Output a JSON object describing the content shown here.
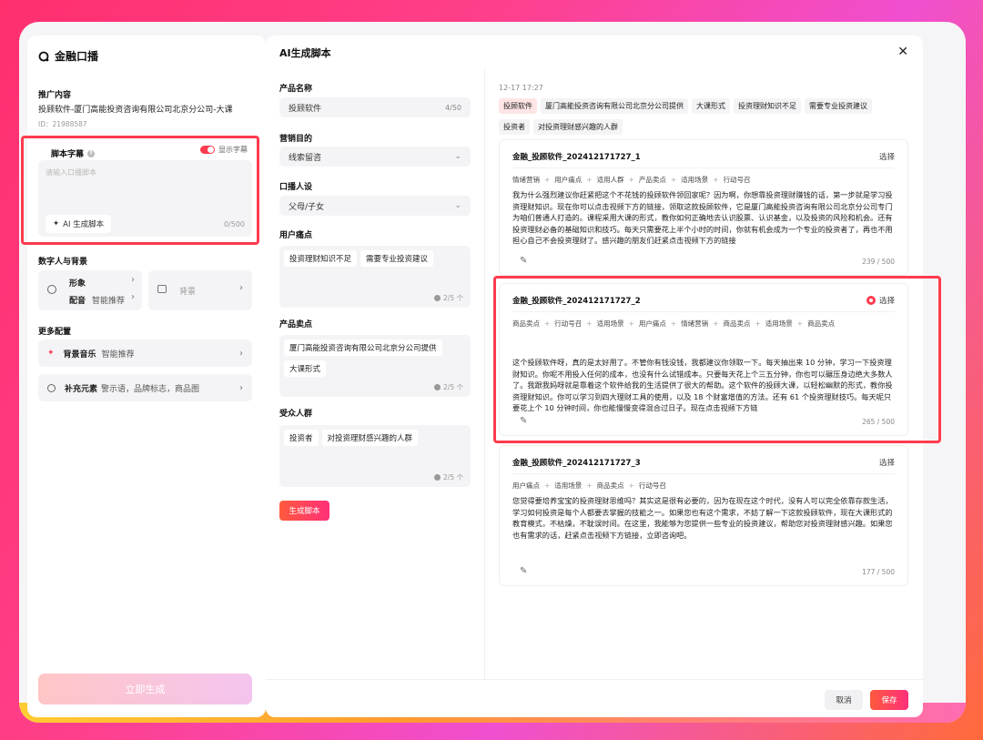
{
  "app": {
    "title": "金融口播"
  },
  "left": {
    "promo": {
      "label": "推广内容",
      "title": "投顾软件-厦门高能投资咨询有限公司北京分公司-大课",
      "id": "ID：21988587"
    },
    "script": {
      "label": "脚本字幕",
      "toggle_label": "显示字幕",
      "placeholder": "请输入口播脚本",
      "ai_button": "AI 生成脚本",
      "count": "0/500"
    },
    "digital": {
      "label": "数字人与背景",
      "image_label": "形象",
      "voice_label": "配音",
      "voice_value": "智能推荐",
      "bg_label": "背景"
    },
    "more": {
      "label": "更多配置",
      "music_label": "背景音乐",
      "music_value": "智能推荐",
      "extra_label": "补充元素",
      "extra_value": "警示语，品牌标志，商品图"
    },
    "generate_button": "立即生成"
  },
  "modal": {
    "title": "AI生成脚本",
    "product_name": {
      "label": "产品名称",
      "value": "投顾软件",
      "count": "4/50"
    },
    "purpose": {
      "label": "营销目的",
      "value": "线索留咨"
    },
    "persona": {
      "label": "口播人设",
      "value": "父母/子女"
    },
    "pain": {
      "label": "用户痛点",
      "chips": [
        "投资理财知识不足",
        "需要专业投资建议"
      ],
      "count": "2/5 个"
    },
    "selling": {
      "label": "产品卖点",
      "chips": [
        "厦门高能投资咨询有限公司北京分公司提供",
        "大课形式"
      ],
      "count": "2/5 个"
    },
    "audience": {
      "label": "受众人群",
      "chips": [
        "投资者",
        "对投资理财感兴趣的人群"
      ],
      "count": "2/5 个"
    },
    "gen_button": "生成脚本",
    "cancel": "取消",
    "save": "保存"
  },
  "results": {
    "date": "12-17  17:27",
    "tags": [
      "投顾软件",
      "厦门高能投资咨询有限公司北京分公司提供",
      "大课形式",
      "投资理财知识不足",
      "需要专业投资建议",
      "投资者",
      "对投资理财感兴趣的人群"
    ],
    "items": [
      {
        "name": "金融_投顾软件_202412171727_1",
        "pick": "选择",
        "tags": [
          "情绪营销",
          "用户痛点",
          "适用人群",
          "产品卖点",
          "适用场景",
          "行动号召"
        ],
        "body": "我为什么强烈建议你赶紧把这个不花钱的投顾软件领回家呢？因为啊，你想靠投资理财赚钱的话，第一步就是学习投资理财知识。现在你可以点击视频下方的链接，领取这款投顾软件，它是厦门高能投资咨询有限公司北京分公司专门为咱们普通人打造的。课程采用大课的形式，教你如何正确地去认识股票、认识基金，以及投资的风险和机会。还有投资理财必备的基础知识和技巧。每天只需要花上半个小时的时间，你就有机会成为一个专业的投资者了，再也不用担心自己不会投资理财了。感兴趣的朋友们赶紧点击视频下方的链接",
        "count": "239 / 500"
      },
      {
        "name": "金融_投顾软件_202412171727_2",
        "pick": "选择",
        "tags": [
          "商品卖点",
          "行动号召",
          "适用场景",
          "用户痛点",
          "情绪营销",
          "商品卖点",
          "适用场景",
          "商品卖点"
        ],
        "body": "这个投顾软件呀，真的是太好用了。不管你有钱没钱，我都建议你领取一下。每天抽出来 10 分钟，学习一下投资理财知识。你呢不用投入任何的成本，也没有什么试错成本。只要每天花上个三五分钟，你也可以碾压身边绝大多数人了。我跟我妈呀就是靠着这个软件给我的生活提供了很大的帮助。这个软件的投顾大课，以轻松幽默的形式，教你投资理财知识。你可以学习到四大理财工具的使用，以及 18 个财富增值的方法。还有 61 个投资理财技巧。每天呢只要花上个 10 分钟时间，你也能慢慢变得混合过日子。现在点击视频下方链",
        "count": "265 / 500"
      },
      {
        "name": "金融_投顾软件_202412171727_3",
        "pick": "选择",
        "tags": [
          "用户痛点",
          "适用场景",
          "商品卖点",
          "行动号召"
        ],
        "body": "您觉得要培养宝宝的投资理财思维吗？其实这是很有必要的，因为在现在这个时代，没有人可以完全依靠存款生活，学习如何投资是每个人都要去掌握的技能之一。如果您也有这个需求，不妨了解一下这款投顾软件，现在大课形式的教育模式，不枯燥，不耽误时间。在这里，我能够为您提供一些专业的投资建议，帮助您对投资理财感兴趣。如果您也有需求的话，赶紧点击视频下方链接，立即咨询吧。",
        "count": "177 / 500"
      }
    ]
  },
  "colors": {
    "accent": "#ff3b4e",
    "brand_gradient_start": "#ff5a3d",
    "brand_gradient_end": "#ff2f7a"
  }
}
